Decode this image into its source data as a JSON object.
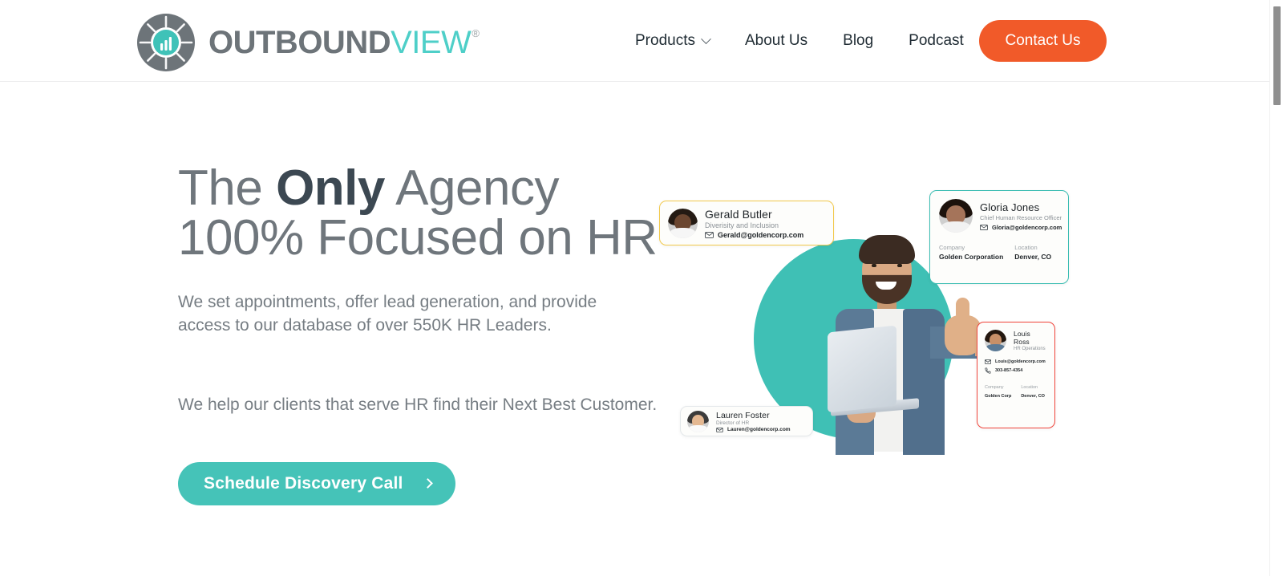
{
  "header": {
    "logo": {
      "icon": "outboundview-compass-logo-icon",
      "word_primary": "OUTBOUND",
      "word_secondary": "VIEW",
      "trademark": "®"
    },
    "nav": [
      {
        "label": "Products",
        "has_dropdown": true,
        "icon": "chevron-down-icon"
      },
      {
        "label": "About Us",
        "has_dropdown": false
      },
      {
        "label": "Blog",
        "has_dropdown": false
      },
      {
        "label": "Podcast",
        "has_dropdown": false
      }
    ],
    "cta": {
      "label": "Contact Us",
      "color": "#f15a29"
    }
  },
  "hero": {
    "title": {
      "line1_pre": "The ",
      "line1_bold": "Only",
      "line1_post": " Agency",
      "line2": "100% Focused on HR"
    },
    "subtitle": "We set appointments, offer lead generation, and provide access to our database of over 550K HR Leaders.",
    "tagline": "We help our clients that serve HR find their Next Best Customer.",
    "cta": {
      "label": "Schedule Discovery Call",
      "icon": "chevron-right-icon",
      "color": "#45c3b8"
    }
  },
  "hero_art": {
    "circle_color": "#3fc0b5",
    "person_alt": "smiling-bearded-man-holding-laptop-thumbs-up",
    "cards": [
      {
        "id": "gerald",
        "name": "Gerald Butler",
        "role": "Diverisity and Inclusion",
        "email": "Gerald@goldencorp.com",
        "border_color": "#f2c94c",
        "mail_icon": "envelope-icon"
      },
      {
        "id": "gloria",
        "name": "Gloria Jones",
        "role": "Chief Human Resource Officer",
        "email": "Gloria@goldencorp.com",
        "company_label": "Company",
        "company": "Golden Corporation",
        "location_label": "Location",
        "location": "Denver, CO",
        "border_color": "#3bbdb2",
        "mail_icon": "envelope-icon"
      },
      {
        "id": "louis",
        "name": "Louis Ross",
        "role": "HR Operations",
        "email": "Louis@goldencorp.com",
        "phone": "303-857-4354",
        "company_label": "Company",
        "company": "Golden Corp",
        "location_label": "Location",
        "location": "Denver, CO",
        "border_color": "#f0453c",
        "mail_icon": "envelope-icon",
        "phone_icon": "phone-icon"
      },
      {
        "id": "lauren",
        "name": "Lauren Foster",
        "role": "Director of HR",
        "email": "Lauren@goldencorp.com",
        "border_color": "#e4e8ea",
        "mail_icon": "envelope-icon"
      }
    ]
  }
}
